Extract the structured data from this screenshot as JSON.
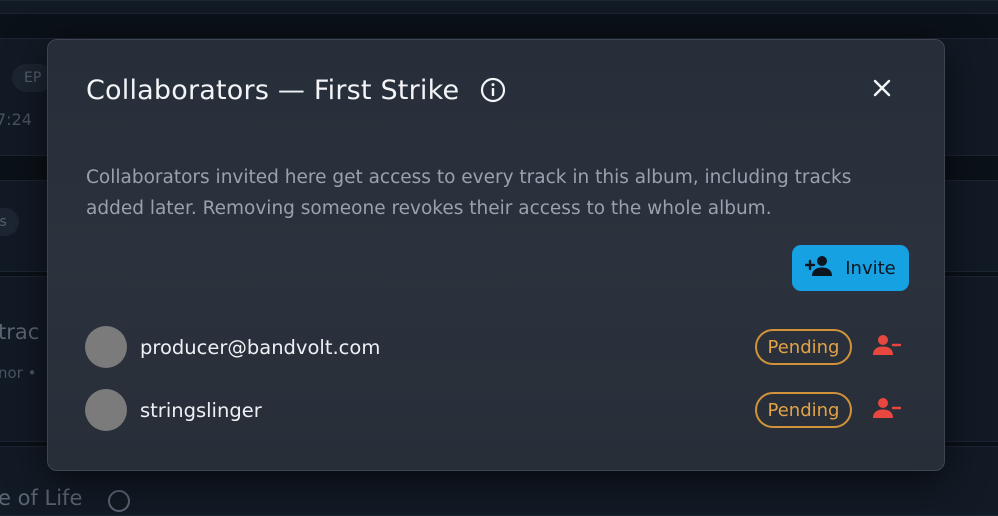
{
  "background": {
    "chip_1": "EP",
    "chip_2": "ts",
    "time_text": "7:24",
    "track_title_fragment": "trac",
    "track_meta_fragment": "nor •",
    "bottom_title_fragment": "e of Life"
  },
  "modal": {
    "title": "Collaborators — First Strike",
    "description": "Collaborators invited here get access to every track in this album, including tracks added later. Removing someone revokes their access to the whole album.",
    "invite_label": "Invite",
    "collaborators": [
      {
        "name": "producer@bandvolt.com",
        "status": "Pending"
      },
      {
        "name": "stringslinger",
        "status": "Pending"
      }
    ]
  },
  "colors": {
    "accent": "#16a1e3",
    "pending": "#e3a244",
    "remove": "#e8473f"
  },
  "icons": {
    "info": "info-icon",
    "close": "close-icon",
    "invite": "person-add-icon",
    "remove": "person-remove-icon"
  }
}
